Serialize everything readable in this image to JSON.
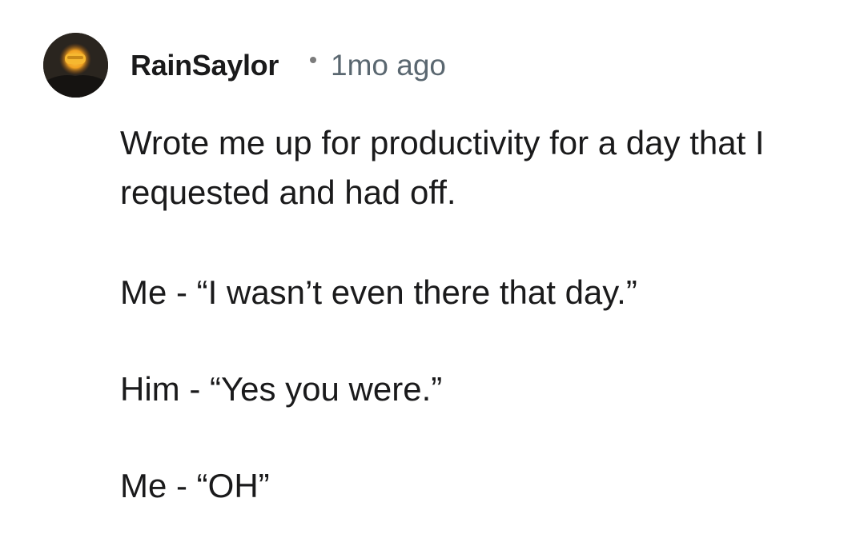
{
  "comment": {
    "author": "RainSaylor",
    "separator": "•",
    "time_ago": "1mo ago",
    "avatar_icon": "user-avatar-icon",
    "paragraphs": [
      "Wrote me up for productivity for a day that I requested and had off.",
      "Me - “I wasn’t even there that day.”",
      "Him - “Yes you were.”",
      "Me - “OH”"
    ]
  },
  "colors": {
    "text": "#1a1a1b",
    "meta": "#5a6770",
    "background": "#ffffff"
  }
}
